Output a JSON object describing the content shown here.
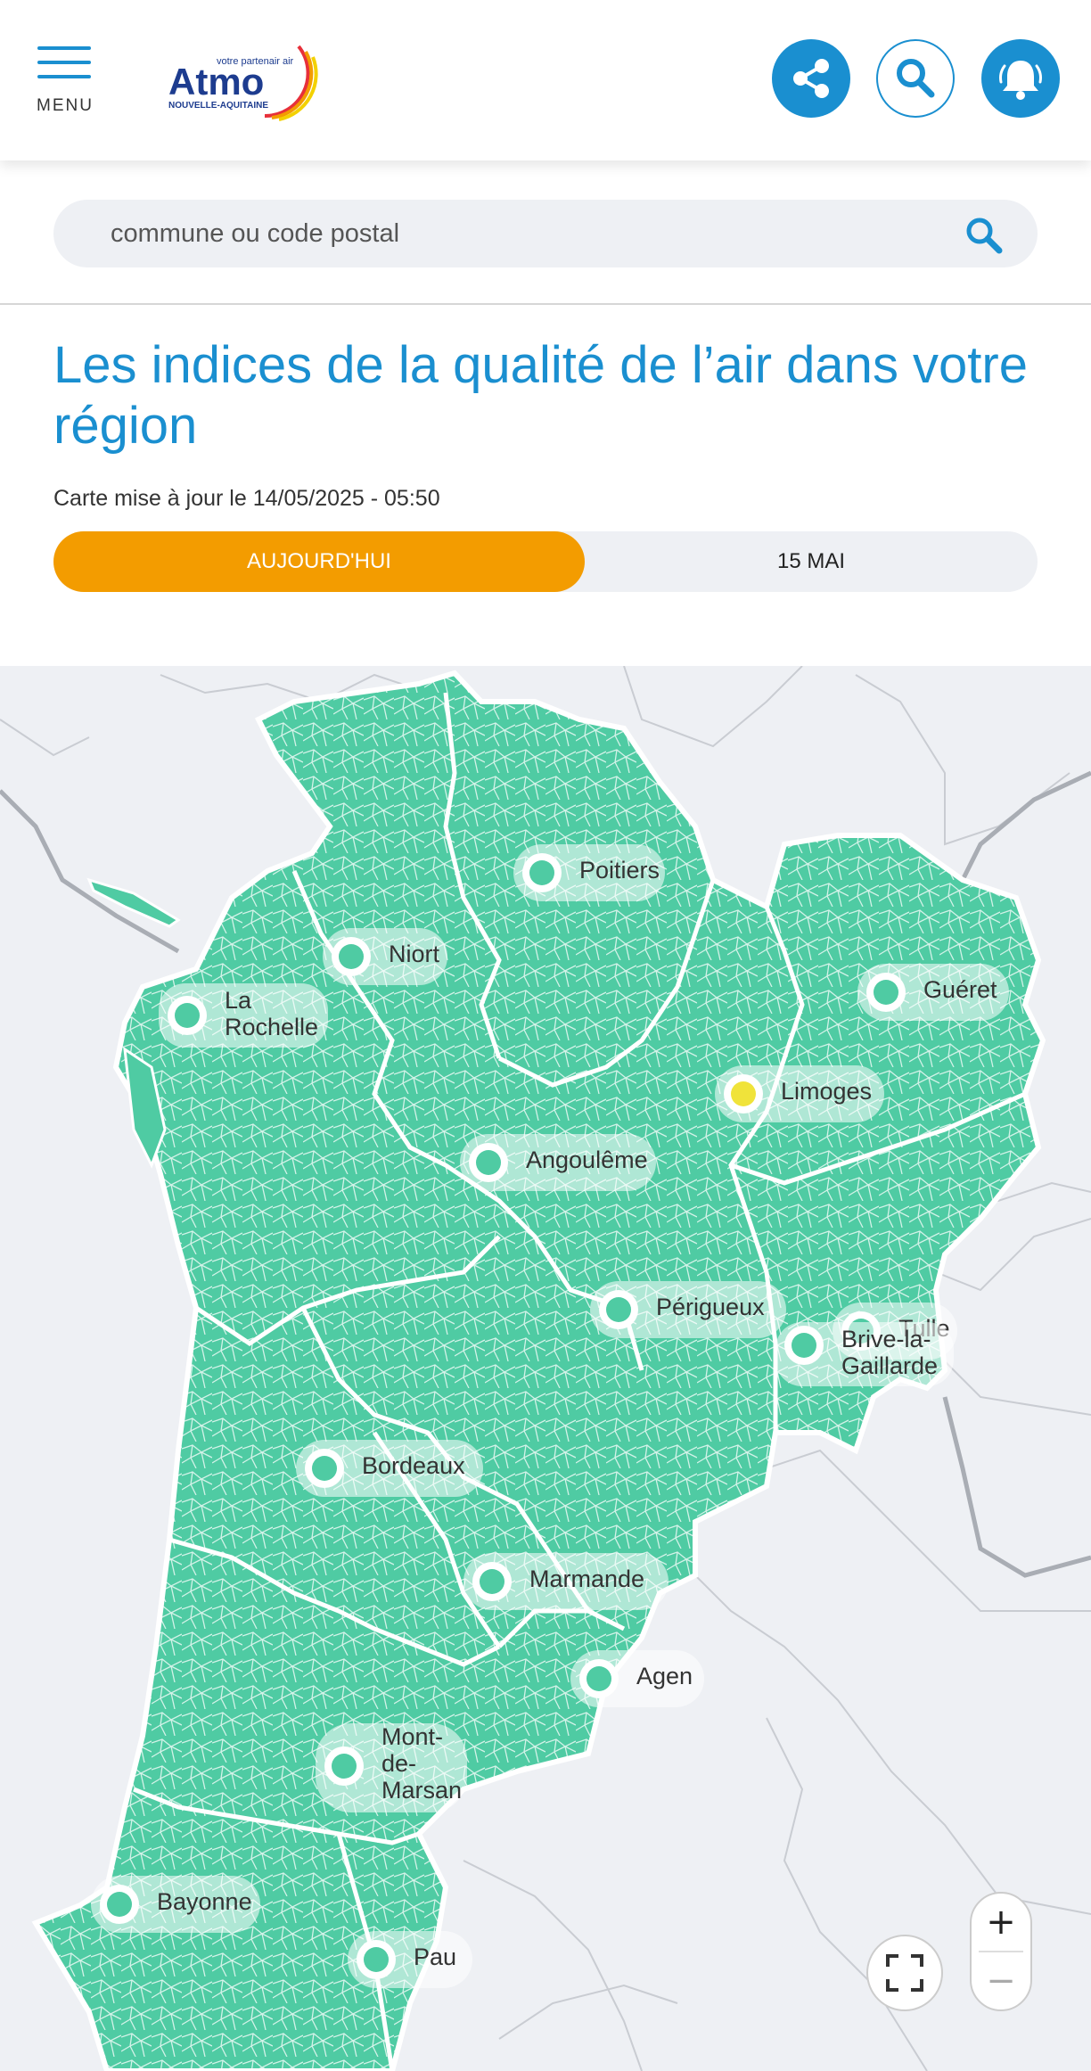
{
  "header": {
    "menu_label": "MENU",
    "logo": {
      "tagline": "votre partenair air",
      "name": "Atmo",
      "region": "NOUVELLE-AQUITAINE"
    },
    "share_icon": "share-icon",
    "search_icon": "search-icon",
    "bell_icon": "bell-icon"
  },
  "search": {
    "placeholder": "commune ou code postal"
  },
  "main": {
    "title": "Les indices de la qualité de l’air dans votre région",
    "updated": "Carte mise à jour le 14/05/2025 - 05:50",
    "tabs": [
      {
        "label": "AUJOURD'HUI",
        "active": true
      },
      {
        "label": "15 MAI",
        "active": false
      }
    ]
  },
  "map": {
    "region_color": "#4fcba3",
    "cities": [
      {
        "name": "Poitiers",
        "level": "good",
        "color": "#4fcba3"
      },
      {
        "name": "Niort",
        "level": "good",
        "color": "#4fcba3"
      },
      {
        "name": "La\nRochelle",
        "level": "good",
        "color": "#4fcba3"
      },
      {
        "name": "Guéret",
        "level": "good",
        "color": "#4fcba3"
      },
      {
        "name": "Limoges",
        "level": "average",
        "color": "#f0e33a"
      },
      {
        "name": "Angoulême",
        "level": "good",
        "color": "#4fcba3"
      },
      {
        "name": "Tulle",
        "level": "good",
        "color": "#4fcba3"
      },
      {
        "name": "Périgueux",
        "level": "good",
        "color": "#4fcba3"
      },
      {
        "name": "Brive-la-\nGaillarde",
        "level": "good",
        "color": "#4fcba3"
      },
      {
        "name": "Bordeaux",
        "level": "good",
        "color": "#4fcba3"
      },
      {
        "name": "Marmande",
        "level": "good",
        "color": "#4fcba3"
      },
      {
        "name": "Agen",
        "level": "good",
        "color": "#4fcba3"
      },
      {
        "name": "Mont-\nde-\nMarsan",
        "level": "good",
        "color": "#4fcba3"
      },
      {
        "name": "Bayonne",
        "level": "good",
        "color": "#4fcba3"
      },
      {
        "name": "Pau",
        "level": "good",
        "color": "#4fcba3"
      }
    ],
    "controls": {
      "zoom_in": "+",
      "zoom_out": "−"
    }
  }
}
